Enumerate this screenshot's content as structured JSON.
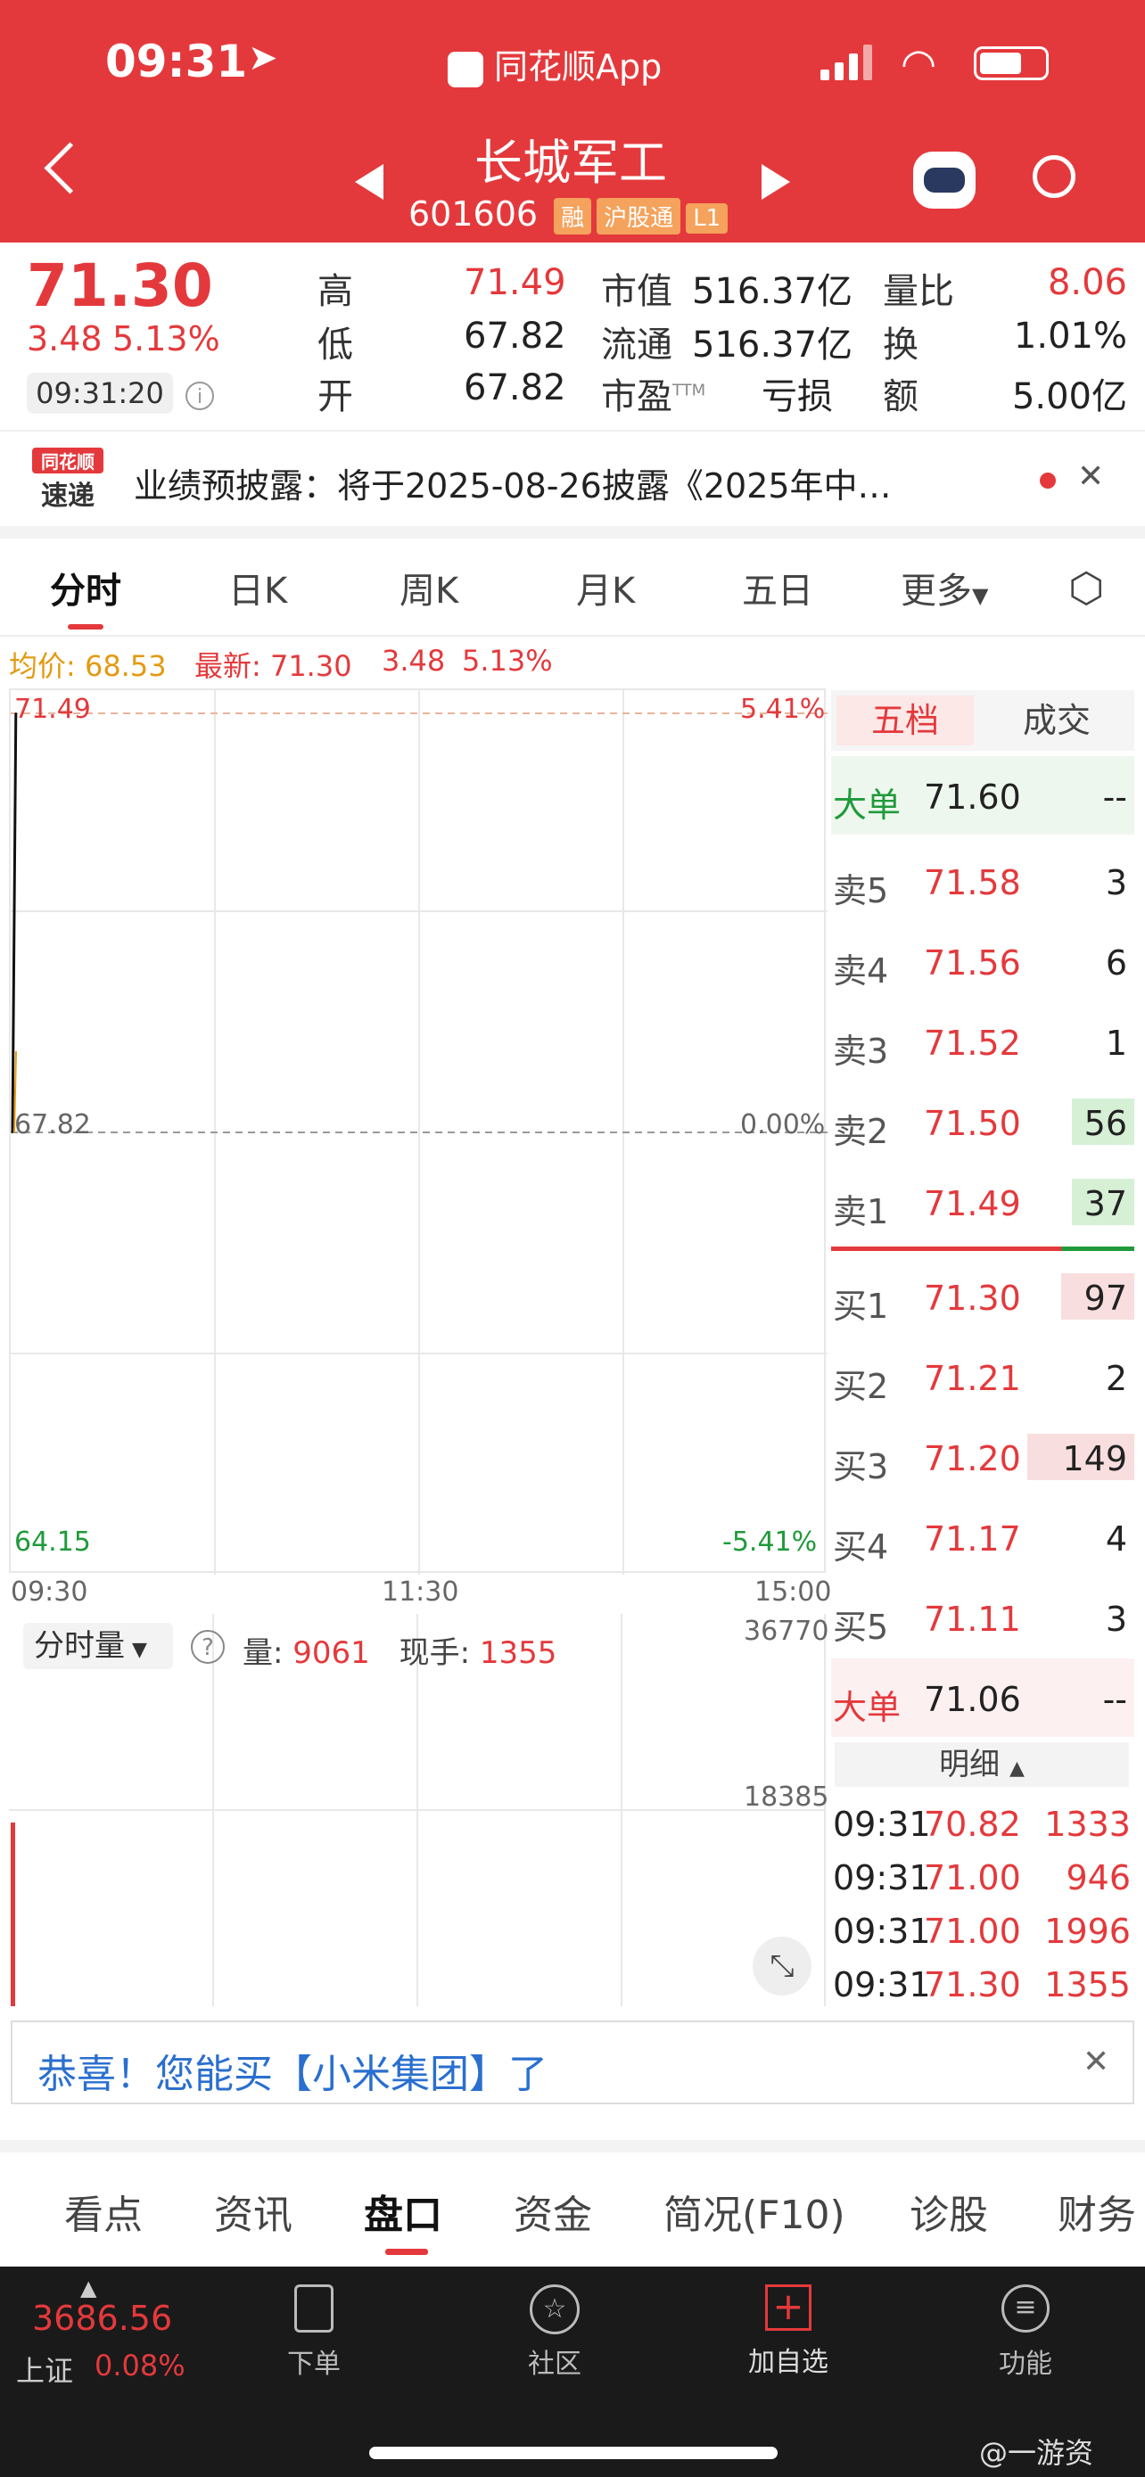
{
  "status_bar": {
    "time": "09:31",
    "app_name": "同花顺App"
  },
  "stock_header": {
    "name": "长城军工",
    "code": "601606",
    "tags": [
      "融",
      "沪股通",
      "L1"
    ]
  },
  "quote": {
    "price": "71.30",
    "change": "3.48",
    "change_pct": "5.13%",
    "time": "09:31:20",
    "high_label": "高",
    "high": "71.49",
    "low_label": "低",
    "low": "67.82",
    "open_label": "开",
    "open": "67.82",
    "mcap_label": "市值",
    "mcap": "516.37亿",
    "float_label": "流通",
    "float": "516.37亿",
    "pe_label": "市盈",
    "pe_sup": "TTM",
    "pe": "亏损",
    "vol_ratio_label": "量比",
    "vol_ratio": "8.06",
    "turnover_label": "换",
    "turnover": "1.01%",
    "amount_label": "额",
    "amount": "5.00亿"
  },
  "news": {
    "logo_top": "同花顺",
    "logo_bottom": "速递",
    "text": "业绩预披露：将于2025-08-26披露《2025年中…"
  },
  "chart_tabs": [
    "分时",
    "日K",
    "周K",
    "月K",
    "五日",
    "更多"
  ],
  "info_line": {
    "avg_label": "均价: 68.53",
    "last_label": "最新: 71.30",
    "change": "3.48",
    "pct": "5.13%"
  },
  "chart_axis": {
    "y_top": "71.49",
    "y_mid": "67.82",
    "y_bot": "64.15",
    "pct_top": "5.41%",
    "pct_mid": "0.00%",
    "pct_bot": "-5.41%",
    "x_start": "09:30",
    "x_mid": "11:30",
    "x_end": "15:00"
  },
  "volume": {
    "selector": "分时量",
    "qty_label": "量:",
    "qty": "9061",
    "hand_label": "现手:",
    "hand": "1355",
    "y_top": "36770",
    "y_mid": "18385"
  },
  "chart_data": {
    "type": "line",
    "x": [
      "09:30",
      "09:31"
    ],
    "series": [
      {
        "values": [
          67.82,
          71.49
        ]
      }
    ],
    "ylim": [
      64.15,
      71.49
    ],
    "volume": [
      9061
    ]
  },
  "orderbook": {
    "tabs": [
      "五档",
      "成交"
    ],
    "big_top": {
      "label": "大单",
      "price": "71.60",
      "qty": "--"
    },
    "sells": [
      {
        "label": "卖5",
        "price": "71.58",
        "qty": "3"
      },
      {
        "label": "卖4",
        "price": "71.56",
        "qty": "6"
      },
      {
        "label": "卖3",
        "price": "71.52",
        "qty": "1"
      },
      {
        "label": "卖2",
        "price": "71.50",
        "qty": "56"
      },
      {
        "label": "卖1",
        "price": "71.49",
        "qty": "37"
      }
    ],
    "buys": [
      {
        "label": "买1",
        "price": "71.30",
        "qty": "97"
      },
      {
        "label": "买2",
        "price": "71.21",
        "qty": "2"
      },
      {
        "label": "买3",
        "price": "71.20",
        "qty": "149"
      },
      {
        "label": "买4",
        "price": "71.17",
        "qty": "4"
      },
      {
        "label": "买5",
        "price": "71.11",
        "qty": "3"
      }
    ],
    "big_bottom": {
      "label": "大单",
      "price": "71.06",
      "qty": "--"
    },
    "detail_label": "明细",
    "details": [
      {
        "time": "09:31",
        "price": "70.82",
        "qty": "1333"
      },
      {
        "time": "09:31",
        "price": "71.00",
        "qty": "946"
      },
      {
        "time": "09:31",
        "price": "71.00",
        "qty": "1996"
      },
      {
        "time": "09:31",
        "price": "71.30",
        "qty": "1355"
      }
    ]
  },
  "promo": {
    "text": "恭喜！您能买【小米集团】了"
  },
  "bottom_tabs": [
    "看点",
    "资讯",
    "盘口",
    "资金",
    "简况(F10)",
    "诊股",
    "财务"
  ],
  "nav": {
    "index_value": "3686.56",
    "index_name": "上证",
    "index_pct": "0.08%",
    "items": [
      "下单",
      "社区",
      "加自选",
      "功能"
    ]
  },
  "watermark": "@一游资",
  "colors": {
    "brand_red": "#e4393c",
    "green": "#1f9a3a"
  }
}
